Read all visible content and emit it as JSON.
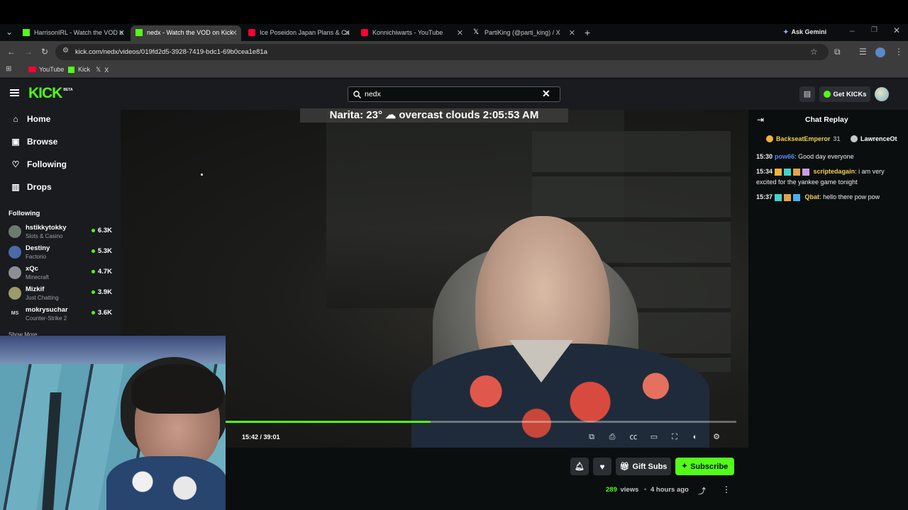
{
  "browser": {
    "tabs": [
      {
        "title": "HarrisonIRL - Watch the VOD o",
        "favicon": "kick-icon",
        "active": false
      },
      {
        "title": "nedx - Watch the VOD on Kick",
        "favicon": "kick-icon",
        "active": true
      },
      {
        "title": "Ice Poseidon Japan Plans & Ca",
        "favicon": "youtube-icon",
        "active": false
      },
      {
        "title": "Konnichiwarts - YouTube",
        "favicon": "youtube-icon",
        "active": false
      },
      {
        "title": "PartiKing (@parti_king) / X",
        "favicon": "x-icon",
        "active": false
      }
    ],
    "ask_gemini": "Ask Gemini",
    "url": "kick.com/nedx/videos/019fd2d5-3928-7419-bdc1-69b0cea1e81a",
    "bookmarks": [
      {
        "label": "YouTube",
        "icon": "youtube-icon"
      },
      {
        "label": "Kick",
        "icon": "kick-icon"
      },
      {
        "label": "X",
        "icon": "x-icon"
      }
    ]
  },
  "kick": {
    "logo": "KICK",
    "logo_badge": "BETA",
    "search_value": "nedx",
    "get_kicks": "Get KICKs",
    "nav": [
      {
        "label": "Home",
        "icon": "home-icon"
      },
      {
        "label": "Browse",
        "icon": "browse-icon"
      },
      {
        "label": "Following",
        "icon": "heart-icon"
      },
      {
        "label": "Drops",
        "icon": "drops-icon"
      }
    ],
    "following_heading": "Following",
    "following": [
      {
        "name": "hstikkytokky",
        "game": "Slots & Casino",
        "viewers": "6.3K"
      },
      {
        "name": "Destiny",
        "game": "Factorio",
        "viewers": "5.3K"
      },
      {
        "name": "xQc",
        "game": "Minecraft",
        "viewers": "4.7K"
      },
      {
        "name": "Mizkif",
        "game": "Just Chatting",
        "viewers": "3.9K"
      },
      {
        "name": "mokrysuchar",
        "game": "Counter-Strike 2",
        "viewers": "3.6K"
      }
    ],
    "mokrysuchar_initials": "MS",
    "show_more": "Show More"
  },
  "video": {
    "weather_overlay": "Narita: 23° ☁ overcast clouds 2:05:53 AM",
    "time": "15:42 / 39:01",
    "progress": 0.402
  },
  "chat": {
    "title": "Chat Replay",
    "pinned": [
      {
        "name": "BackseatEmperor",
        "count": "31"
      },
      {
        "name": "LawrenceOt",
        "count": ""
      }
    ],
    "messages": [
      {
        "time": "15:30",
        "user": "pow66",
        "user_color": "#4f8df7",
        "text": "Good day everyone"
      },
      {
        "time": "15:34",
        "user": "scriptedagain",
        "user_color": "#f2d14b",
        "text": "i am very excited for the yankee game tonight"
      },
      {
        "time": "15:37",
        "user": "Qbat",
        "user_color": "#f2d14b",
        "text": "hello there pow pow"
      }
    ]
  },
  "actions": {
    "gift_subs": "Gift Subs",
    "subscribe": "Subscribe",
    "views_count": "289",
    "views_label": "views",
    "uploaded": "4 hours ago"
  },
  "colors": {
    "kick_green": "#53fc18",
    "sidebar_bg": "#191b1f",
    "page_bg": "#0b0e0f"
  }
}
